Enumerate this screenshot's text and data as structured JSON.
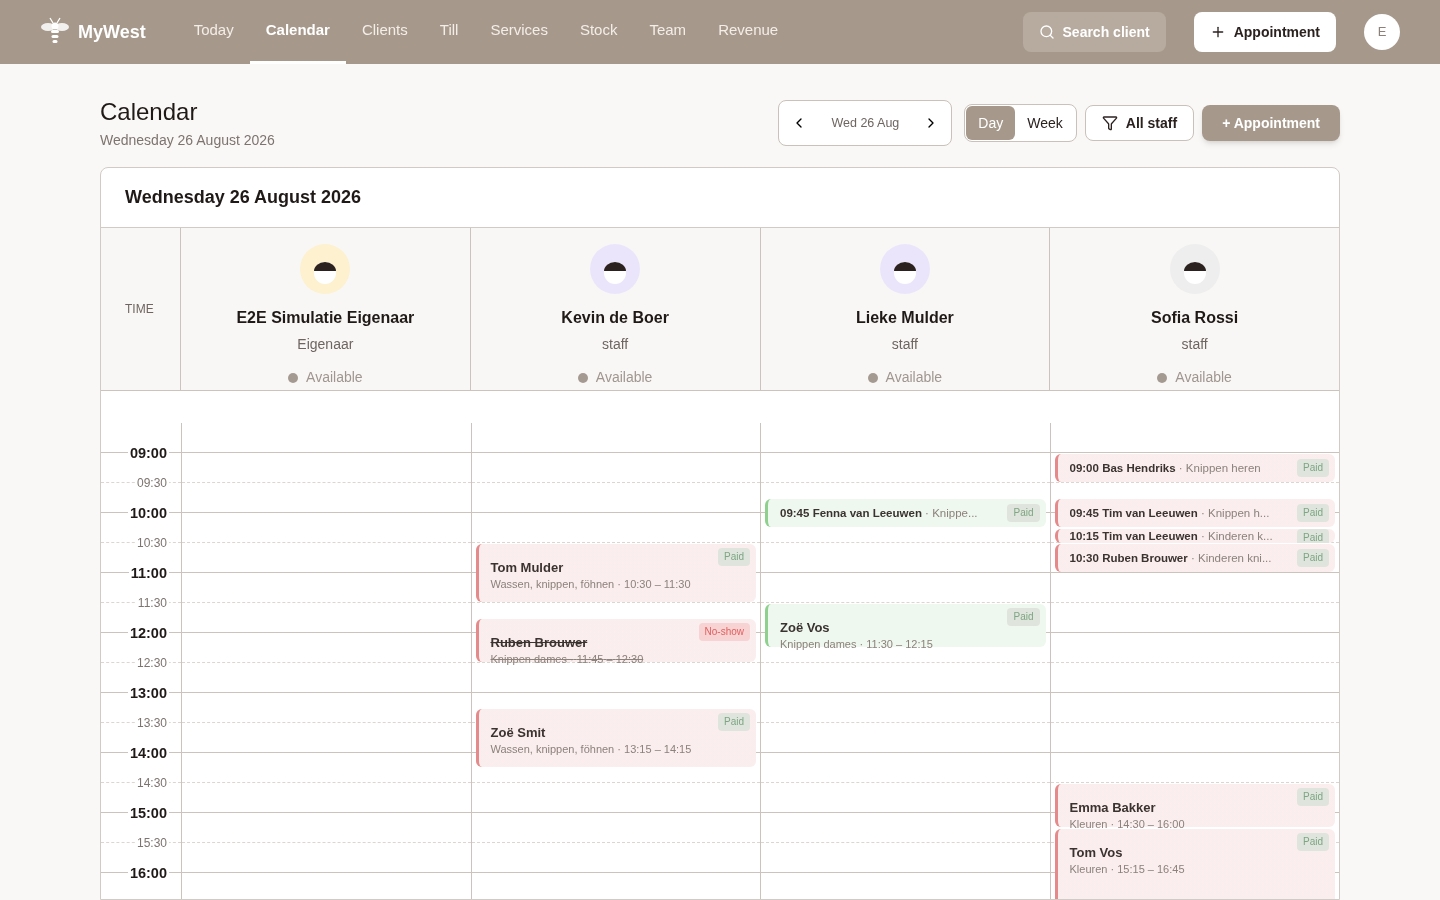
{
  "app": {
    "name": "MyWest"
  },
  "nav": [
    {
      "label": "Today",
      "selected": false
    },
    {
      "label": "Calendar",
      "selected": true
    },
    {
      "label": "Clients",
      "selected": false
    },
    {
      "label": "Till",
      "selected": false
    },
    {
      "label": "Services",
      "selected": false
    },
    {
      "label": "Stock",
      "selected": false
    },
    {
      "label": "Team",
      "selected": false
    },
    {
      "label": "Revenue",
      "selected": false
    }
  ],
  "search": {
    "placeholder": "Search client"
  },
  "new_appointment": "Appointment",
  "user_initial": "E",
  "page": {
    "title": "Calendar",
    "subtitle": "Wednesday 26 August 2026"
  },
  "date_nav": {
    "label": "Wed 26 Aug"
  },
  "views": [
    {
      "label": "Day",
      "selected": true
    },
    {
      "label": "Week",
      "selected": false
    }
  ],
  "filter": "All staff",
  "add_button": "+ Appointment",
  "calendar": {
    "heading": "Wednesday 26 August 2026",
    "time_header": "TIME",
    "staff": [
      {
        "name": "E2E Simulatie Eigenaar",
        "role": "Eigenaar",
        "status": "Available",
        "color": "#fdf1cf"
      },
      {
        "name": "Kevin de Boer",
        "role": "staff",
        "status": "Available",
        "color": "#ebe5fb",
        "events": [
          {
            "kind": "block",
            "name": "Tom Mulder",
            "service": "Wassen, knippen, föhnen",
            "separator": "·",
            "start": "10:30",
            "dash": "–",
            "end": "11:30",
            "badge": {
              "label": "Paid",
              "kind": "paid"
            },
            "color": "#e48a8a"
          },
          {
            "kind": "block",
            "name": "Ruben Brouwer",
            "service": "Knippen dames",
            "separator": "·",
            "start": "11:45",
            "dash": "–",
            "end": "12:30",
            "badge": {
              "label": "No-show",
              "kind": "noshow"
            },
            "color": "#e48a8a"
          },
          {
            "kind": "block",
            "name": "Zoë Smit",
            "service": "Wassen, knippen, föhnen",
            "separator": "·",
            "start": "13:15",
            "dash": "–",
            "end": "14:15",
            "badge": {
              "label": "Paid",
              "kind": "paid"
            },
            "color": "#e48a8a"
          }
        ]
      },
      {
        "name": "Lieke Mulder",
        "role": "staff",
        "status": "Available",
        "color": "#ebe5fb",
        "events": [
          {
            "kind": "compact",
            "start": "09:45",
            "name": "Fenna van Leeuwen",
            "detail": "· Knippe...",
            "badge": {
              "label": "Paid",
              "kind": "paid"
            },
            "color": "#8fd08f"
          },
          {
            "kind": "block",
            "name": "Zoë Vos",
            "service": "Knippen dames",
            "separator": "·",
            "start": "11:30",
            "dash": "–",
            "end": "12:15",
            "badge": {
              "label": "Paid",
              "kind": "paid"
            },
            "color": "#8fd08f"
          }
        ]
      },
      {
        "name": "Sofia Rossi",
        "role": "staff",
        "status": "Available",
        "color": "#eeeeee",
        "events": [
          {
            "kind": "compact",
            "start": "09:00",
            "name": "Bas Hendriks",
            "detail": "· Knippen heren",
            "badge": {
              "label": "Paid",
              "kind": "paid"
            },
            "color": "#e48a8a"
          },
          {
            "kind": "compact",
            "start": "09:45",
            "name": "Tim van Leeuwen",
            "detail": "· Knippen h...",
            "badge": {
              "label": "Paid",
              "kind": "paid"
            },
            "color": "#e48a8a"
          },
          {
            "kind": "short",
            "start": "10:15",
            "name": "Tim van Leeuwen",
            "detail": "· Kinderen k...",
            "badge": {
              "label": "Paid",
              "kind": "paid"
            },
            "color": "#e48a8a"
          },
          {
            "kind": "compact",
            "start": "10:30",
            "name": "Ruben Brouwer",
            "detail": "· Kinderen kni...",
            "badge": {
              "label": "Paid",
              "kind": "paid"
            },
            "color": "#e48a8a"
          },
          {
            "kind": "block",
            "name": "Emma Bakker",
            "service": "Kleuren",
            "separator": "·",
            "start": "14:30",
            "dash": "–",
            "end": "16:00",
            "badge": {
              "label": "Paid",
              "kind": "paid"
            },
            "color": "#e48a8a"
          },
          {
            "kind": "block",
            "name": "Tom Vos",
            "service": "Kleuren",
            "separator": "·",
            "start": "15:15",
            "dash": "–",
            "end": "16:45",
            "badge": {
              "label": "Paid",
              "kind": "paid"
            },
            "color": "#e48a8a"
          }
        ]
      }
    ],
    "times": [
      "09:00",
      "09:30",
      "10:00",
      "10:30",
      "11:00",
      "11:30",
      "12:00",
      "12:30",
      "13:00",
      "13:30",
      "14:00",
      "14:30",
      "15:00",
      "15:30",
      "16:00"
    ]
  }
}
